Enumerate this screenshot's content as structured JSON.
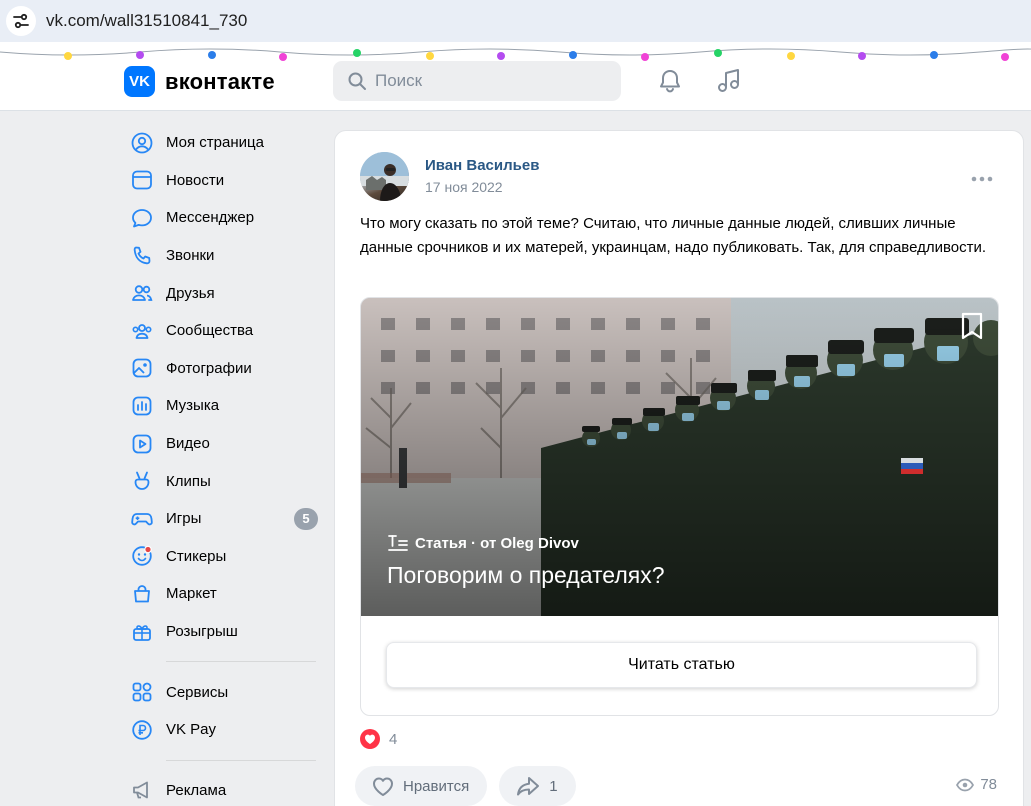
{
  "browser": {
    "url": "vk.com/wall31510841_730"
  },
  "header": {
    "logo_text": "вконтакте",
    "logo_mark": "VK",
    "search_placeholder": "Поиск"
  },
  "sidebar": {
    "items": [
      {
        "label": "Моя страница",
        "icon": "user-circle-icon"
      },
      {
        "label": "Новости",
        "icon": "news-icon"
      },
      {
        "label": "Мессенджер",
        "icon": "message-icon"
      },
      {
        "label": "Звонки",
        "icon": "phone-icon"
      },
      {
        "label": "Друзья",
        "icon": "friends-icon"
      },
      {
        "label": "Сообщества",
        "icon": "communities-icon"
      },
      {
        "label": "Фотографии",
        "icon": "photo-icon"
      },
      {
        "label": "Музыка",
        "icon": "music-icon"
      },
      {
        "label": "Видео",
        "icon": "video-icon"
      },
      {
        "label": "Клипы",
        "icon": "clips-icon"
      },
      {
        "label": "Игры",
        "icon": "gamepad-icon",
        "badge": "5"
      },
      {
        "label": "Стикеры",
        "icon": "sticker-icon"
      },
      {
        "label": "Маркет",
        "icon": "market-icon"
      },
      {
        "label": "Розыгрыш",
        "icon": "gift-icon"
      }
    ],
    "items2": [
      {
        "label": "Сервисы",
        "icon": "services-icon"
      },
      {
        "label": "VK Pay",
        "icon": "vkpay-icon"
      }
    ],
    "items3": [
      {
        "label": "Реклама",
        "icon": "megaphone-icon"
      }
    ]
  },
  "post": {
    "author": "Иван Васильев",
    "date": "17 ноя 2022",
    "text": "Что могу сказать по этой теме? Считаю, что личные данные людей, сливших личные данные срочников и их матерей, украинцам, надо публиковать. Так, для справедливости.",
    "article": {
      "meta": "Статья · от Oleg Divov",
      "title": "Поговорим о предателях?",
      "read_button": "Читать статью"
    },
    "likes_count": "4",
    "like_label": "Нравится",
    "shares_count": "1",
    "views_count": "78"
  },
  "colors": {
    "accent": "#0077ff",
    "link": "#2a5885",
    "muted": "#818c99",
    "like_red": "#ff3347"
  }
}
